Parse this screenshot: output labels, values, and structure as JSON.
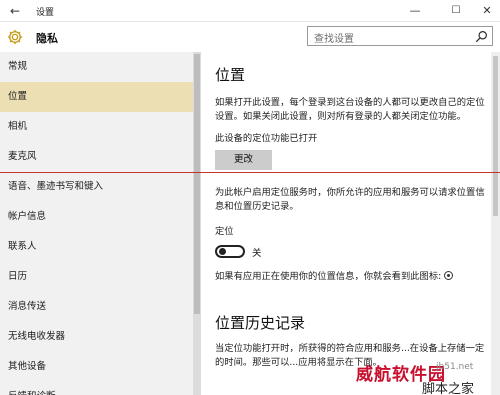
{
  "window": {
    "title": "设置",
    "back_glyph": "←",
    "minimize_glyph": "—",
    "maximize_glyph": "☐",
    "close_glyph": "✕"
  },
  "header": {
    "icon": "gear-icon",
    "section_title": "隐私",
    "search_placeholder": "查找设置",
    "search_icon": "search-icon"
  },
  "sidebar": {
    "selected_color": "#eddfb4",
    "items": [
      {
        "label": "常规"
      },
      {
        "label": "位置",
        "selected": true
      },
      {
        "label": "相机"
      },
      {
        "label": "麦克风"
      },
      {
        "label": "语音、墨迹书写和键入"
      },
      {
        "label": "帐户信息"
      },
      {
        "label": "联系人"
      },
      {
        "label": "日历"
      },
      {
        "label": "消息传送"
      },
      {
        "label": "无线电收发器"
      },
      {
        "label": "其他设备"
      },
      {
        "label": "反馈和诊断"
      }
    ]
  },
  "main": {
    "location_title": "位置",
    "intro": "如果打开此设置，每个登录到这台设备的人都可以更改自己的定位设置。如果关闭此设置，则对所有登录的人都关闭定位功能。",
    "device_status": "此设备的定位功能已打开",
    "change_button": "更改",
    "service_note": "为此帐户启用定位服务时，你所允许的应用和服务可以请求位置信息和位置历史记录。",
    "location_label": "定位",
    "toggle_state": "关",
    "usage_note": "如果有应用正在使用你的位置信息，你就会看到此图标:",
    "usage_icon": "location-pin-icon",
    "history_title": "位置历史记录",
    "history_text": "当定位功能打开时，所获得的符合应用和服务...在设备上存储一定的时间。那些可以...应用将显示在下面。"
  },
  "watermark": {
    "brand": "威航软件园",
    "site": "jb51.net",
    "sub": "脚本之家"
  },
  "colors": {
    "accent": "#eddfb4",
    "annotation_line": "#c4332c",
    "watermark_red": "#c8102e"
  }
}
